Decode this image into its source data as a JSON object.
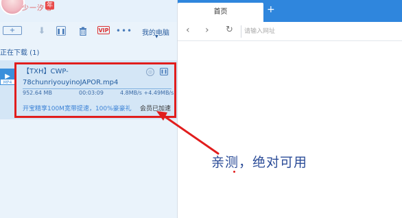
{
  "user": {
    "name": "少一汐七",
    "year_badge": "年"
  },
  "toolbar": {
    "new_icon": "plus-icon",
    "download_icon": "arrow-down-icon",
    "pause_icon": "pause-icon",
    "delete_icon": "trash-icon",
    "vip_label": "VIP",
    "more_label": "•••",
    "my_computer_label": "我的电脑"
  },
  "downloads": {
    "section_label": "正在下载 (1)",
    "items": [
      {
        "file_icon": "video-file-icon",
        "file_ext": "MP4",
        "name": "【TXH】CWP-78chunriyouyinoJAPOR.mp4",
        "size": "952.64 MB",
        "elapsed": "00:03:09",
        "speed": "4.8MB/s +4.49MB/s",
        "accelerate_prompt": "开宝精享100M宽带提速，100%豪豪礼",
        "status": "会员已加速"
      }
    ]
  },
  "browser": {
    "tab_title": "首页",
    "new_tab_label": "+",
    "url_placeholder": "请输入网址"
  },
  "annotation": {
    "text": "亲测，绝对可用",
    "color": "#e11d1d"
  }
}
